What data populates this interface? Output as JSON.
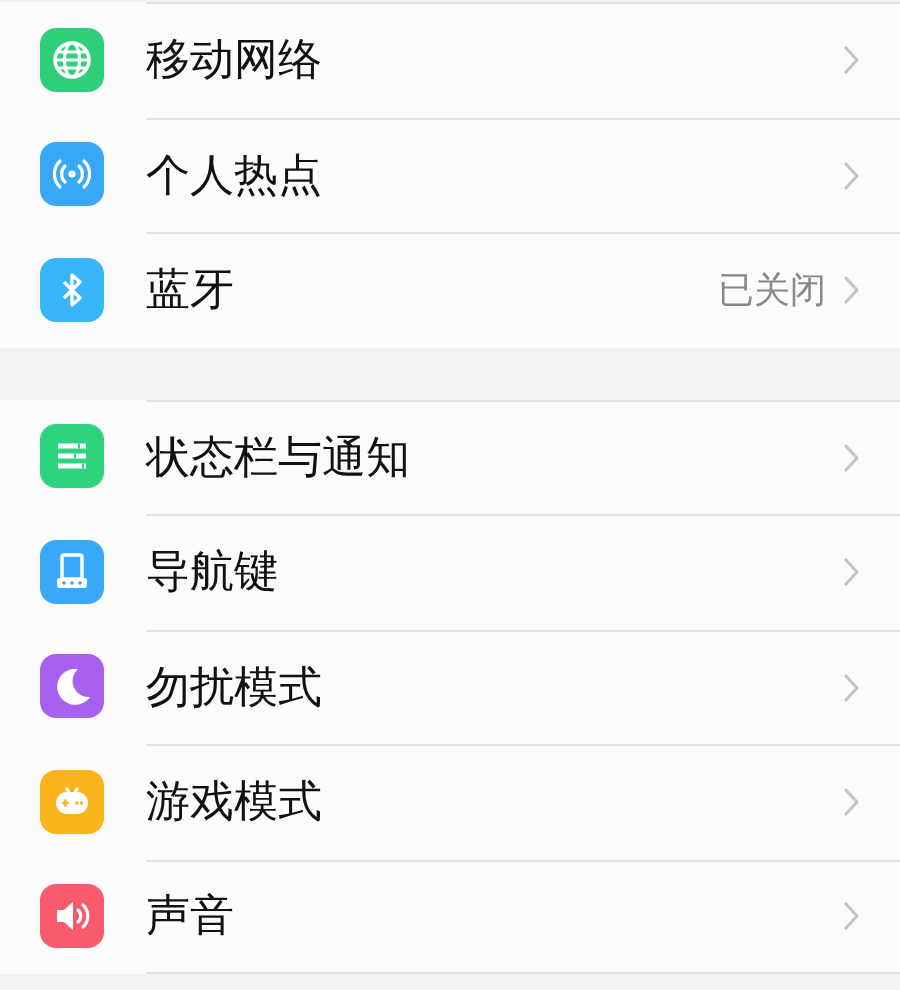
{
  "groups": [
    {
      "items": [
        {
          "kind": "globe",
          "color": "#2ecf7a",
          "label": "移动网络"
        },
        {
          "kind": "hotspot",
          "color": "#3aa8f8",
          "label": "个人热点"
        },
        {
          "kind": "bluetooth",
          "color": "#38b4fa",
          "label": "蓝牙",
          "value": "已关闭"
        }
      ]
    },
    {
      "items": [
        {
          "kind": "statusbar",
          "color": "#2ed37e",
          "label": "状态栏与通知"
        },
        {
          "kind": "navkey",
          "color": "#3aa8f8",
          "label": "导航键"
        },
        {
          "kind": "moon",
          "color": "#a860ee",
          "label": "勿扰模式"
        },
        {
          "kind": "gamepad",
          "color": "#fbb51c",
          "label": "游戏模式"
        },
        {
          "kind": "speaker",
          "color": "#f85a6e",
          "label": "声音"
        }
      ]
    }
  ]
}
